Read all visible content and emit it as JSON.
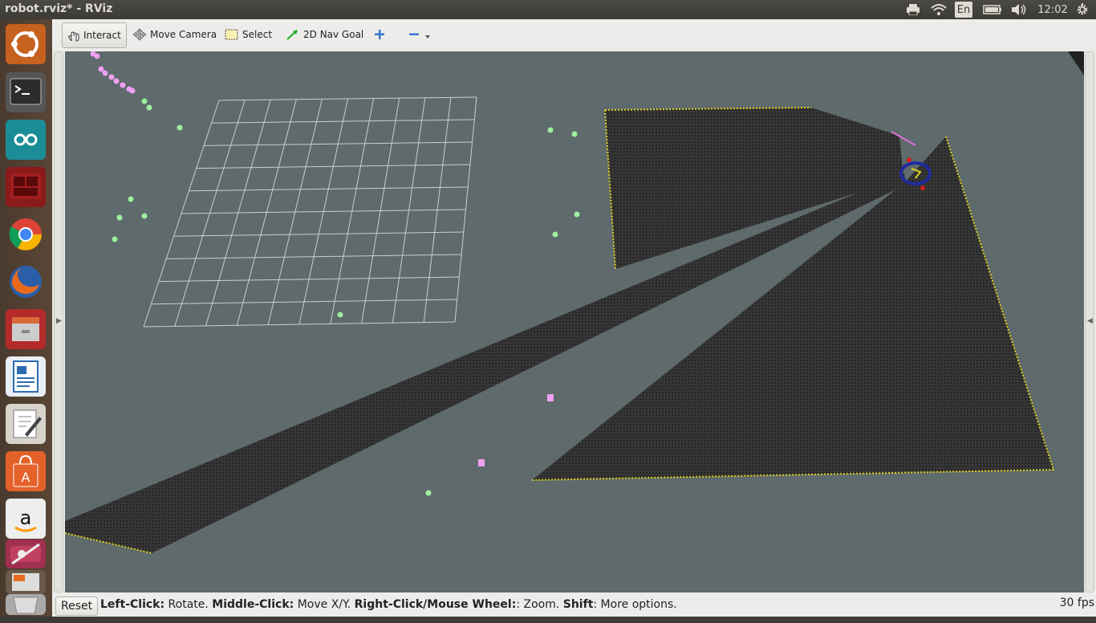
{
  "window": {
    "title": "robot.rviz* - RViz"
  },
  "topbar": {
    "time": "12:02",
    "keyboard_layout": "En"
  },
  "launcher": {
    "items": [
      {
        "name": "ubuntu-dash-icon",
        "color": "#e05a20"
      },
      {
        "name": "terminal-icon",
        "color": "#2c2c2c"
      },
      {
        "name": "arduino-icon",
        "color": "#1a8d96"
      },
      {
        "name": "terminal-red-icon",
        "color": "#a32020"
      },
      {
        "name": "chrome-icon",
        "color": "#ffffff"
      },
      {
        "name": "firefox-icon",
        "color": "#e86a1c"
      },
      {
        "name": "file-manager-icon",
        "color": "#b42a2a"
      },
      {
        "name": "libreoffice-writer-icon",
        "color": "#2d6cb0"
      },
      {
        "name": "text-editor-icon",
        "color": "#d8d4cc"
      },
      {
        "name": "software-center-icon",
        "color": "#e4622a"
      },
      {
        "name": "amazon-icon",
        "color": "#ffffff"
      },
      {
        "name": "system-settings-icon",
        "color": "#a03050"
      },
      {
        "name": "workspace-switcher-icon",
        "color": "#6a5a4a"
      },
      {
        "name": "trash-icon",
        "color": "#cccccc"
      }
    ]
  },
  "toolbar": {
    "interact": "Interact",
    "move_camera": "Move Camera",
    "select": "Select",
    "nav_goal": "2D Nav Goal"
  },
  "status": {
    "reset": "Reset",
    "hint_parts": [
      {
        "b": "Left-Click:",
        "t": " Rotate. "
      },
      {
        "b": "Middle-Click:",
        "t": " Move X/Y. "
      },
      {
        "b": "Right-Click/Mouse Wheel:",
        "t": ": Zoom. "
      },
      {
        "b": "Shift",
        "t": ": More options."
      }
    ],
    "fps": "30 fps"
  },
  "colors": {
    "background": "#5e6a6b",
    "grid": "#c9cfcf",
    "laser_fill": "#2c2c2c",
    "laser_edge": "#e0d020",
    "marker_green": "#9ef09e",
    "marker_pink": "#f0a0f0"
  }
}
